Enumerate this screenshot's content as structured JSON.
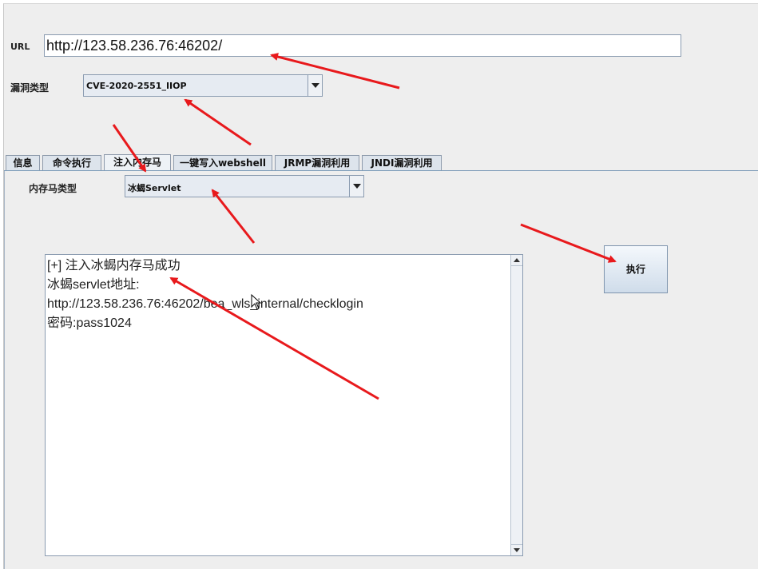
{
  "form": {
    "url_label": "URL",
    "url_value": "http://123.58.236.76:46202/",
    "vuln_type_label": "漏洞类型",
    "vuln_type_value": "CVE-2020-2551_IIOP"
  },
  "tabs": [
    {
      "label": "信息"
    },
    {
      "label": "命令执行"
    },
    {
      "label": "注入内存马"
    },
    {
      "label": "一键写入webshell"
    },
    {
      "label": "JRMP漏洞利用"
    },
    {
      "label": "JNDI漏洞利用"
    }
  ],
  "active_tab": "注入内存马",
  "memshell": {
    "type_label": "内存马类型",
    "type_value": "冰蝎Servlet",
    "execute_label": "执行"
  },
  "output": {
    "lines": [
      "[+] 注入冰蝎内存马成功",
      "冰蝎servlet地址:",
      "http://123.58.236.76:46202/bea_wls_internal/checklogin",
      "密码:pass1024"
    ]
  },
  "colors": {
    "annotation_arrow": "#e8191c",
    "window_bg": "#eeeeee",
    "border": "#8a9bb0"
  },
  "icons": [
    "dropdown-arrow-icon",
    "scroll-up-icon",
    "scroll-down-icon",
    "mouse-cursor-icon"
  ]
}
